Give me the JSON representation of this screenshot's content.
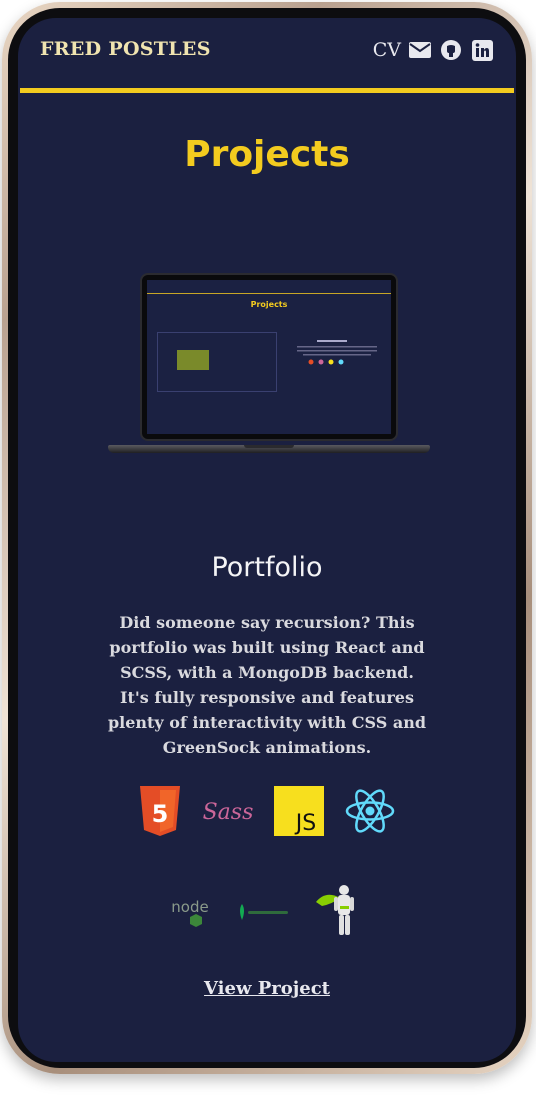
{
  "header": {
    "brand": "FRED POSTLES",
    "cv_label": "CV",
    "icons": [
      "envelope-icon",
      "github-icon",
      "linkedin-icon"
    ]
  },
  "section": {
    "title": "Projects"
  },
  "mockup": {
    "mini_title": "Projects"
  },
  "project": {
    "title": "Portfolio",
    "description": "Did someone say recursion? This portfolio was built using React and SCSS, with a MongoDB backend. It's fully responsive and features plenty of interactivity with CSS and GreenSock animations.",
    "tech_icons_row1": [
      "html5-icon",
      "sass-icon",
      "javascript-icon",
      "react-icon"
    ],
    "tech_icons_row2": [
      "nodejs-icon",
      "mongodb-icon",
      "greensock-icon"
    ],
    "js_label": "JS",
    "sass_label": "Sass",
    "html_label": "5",
    "node_label": "node",
    "link_label": "View Project"
  },
  "colors": {
    "accent": "#f3cb1f",
    "background": "#1b2040",
    "text": "#d9d9de"
  }
}
